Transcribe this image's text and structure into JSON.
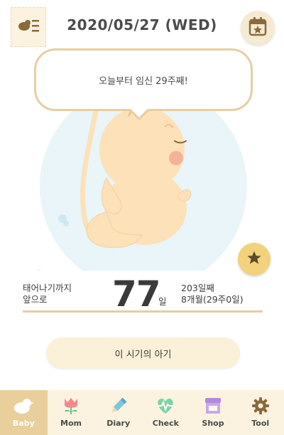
{
  "header": {
    "date_title": "2020/05/27 (WED)",
    "menu_icon": "menu-list-icon",
    "calendar_icon": "calendar-star-icon"
  },
  "bubble": {
    "text": "오늘부터 임신 29주째!"
  },
  "illustration": {
    "subject": "baby-fetus-illustration"
  },
  "info": {
    "left_line1": "태어나기까지",
    "left_line2": "앞으로",
    "days_remaining": "77",
    "days_unit": "일",
    "right_line1": "203일째",
    "right_line2": "8개월(29주0일)"
  },
  "action": {
    "age_button_label": "이 시기의 아기"
  },
  "tabs": [
    {
      "label": "Baby",
      "icon": "bird-icon",
      "active": true
    },
    {
      "label": "Mom",
      "icon": "tulip-icon",
      "active": false
    },
    {
      "label": "Diary",
      "icon": "pencil-icon",
      "active": false
    },
    {
      "label": "Check",
      "icon": "heart-pulse-icon",
      "active": false
    },
    {
      "label": "Shop",
      "icon": "shop-icon",
      "active": false
    },
    {
      "label": "Tool",
      "icon": "gear-icon",
      "active": false
    }
  ],
  "colors": {
    "accent_tan": "#e8cf9b",
    "tabbar_bg": "#fbf3df",
    "star_yellow": "#f2d27a",
    "bg_circle": "#e9f5f8",
    "baby_skin": "#fde1b8"
  }
}
